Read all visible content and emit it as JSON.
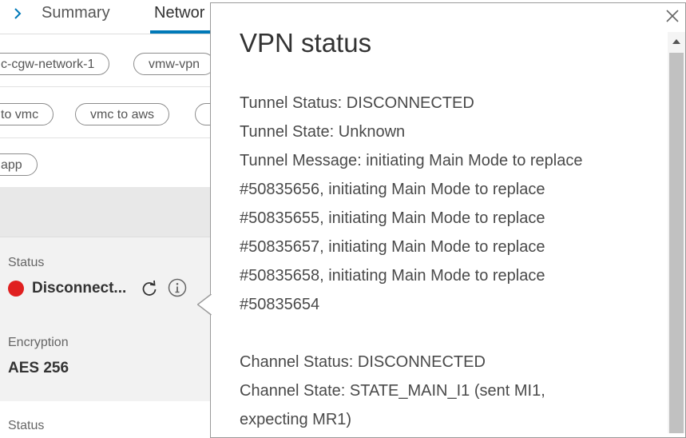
{
  "tabs": {
    "summary": "Summary",
    "network": "Networ"
  },
  "pills": {
    "row1": [
      "c-cgw-network-1",
      "vmw-vpn"
    ],
    "row2": [
      "to vmc",
      "vmc to aws"
    ],
    "row3": [
      "app"
    ]
  },
  "card": {
    "status_label": "Status",
    "status_value": "Disconnect...",
    "encryption_label": "Encryption",
    "encryption_value": "AES 256",
    "status2_label": "Status"
  },
  "popover": {
    "title": "VPN status",
    "lines": [
      "Tunnel Status: DISCONNECTED",
      "Tunnel State: Unknown",
      "Tunnel Message: initiating Main Mode to replace",
      "#50835656, initiating Main Mode to replace",
      "#50835655, initiating Main Mode to replace",
      "#50835657, initiating Main Mode to replace",
      "#50835658, initiating Main Mode to replace",
      "#50835654",
      "",
      "Channel Status: DISCONNECTED",
      "Channel State: STATE_MAIN_I1 (sent MI1,",
      "expecting MR1)"
    ]
  },
  "colors": {
    "accent": "#0079b8",
    "status_red": "#e02020"
  }
}
